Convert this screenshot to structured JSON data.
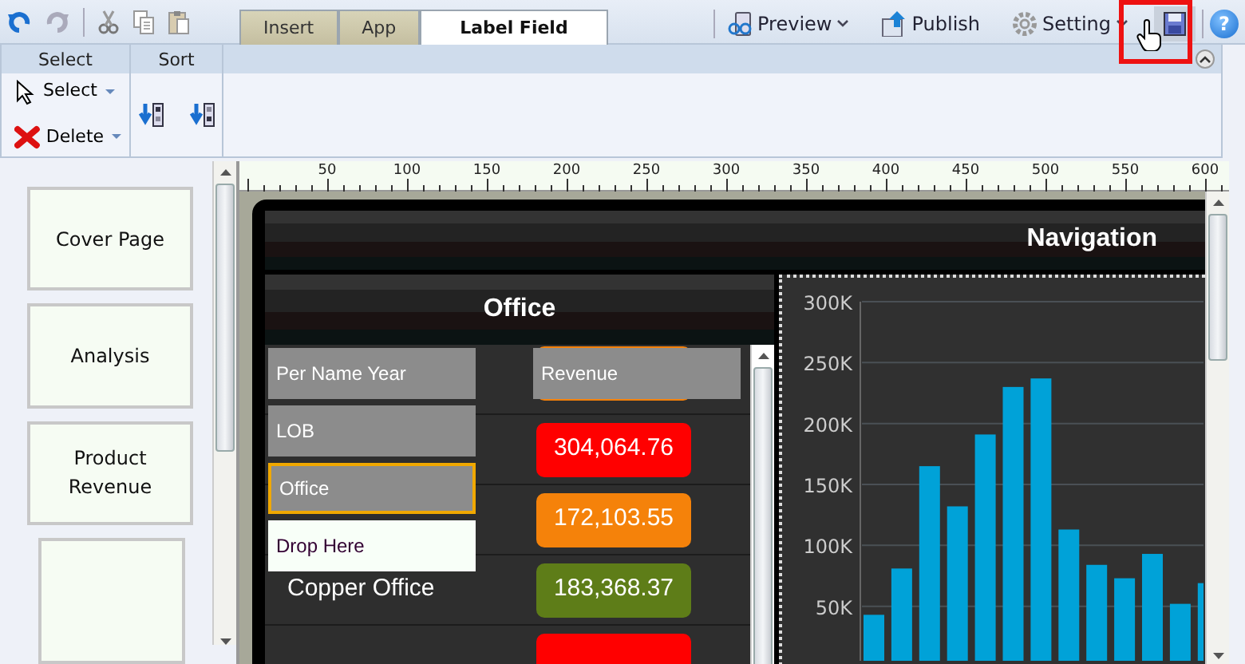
{
  "tabs": [
    {
      "label": "Insert",
      "selected": false
    },
    {
      "label": "App",
      "selected": false
    },
    {
      "label": "Label Field",
      "selected": true
    }
  ],
  "toolbar_actions": [
    {
      "label": "Preview",
      "kind": "preview"
    },
    {
      "label": "Publish",
      "kind": "publish"
    },
    {
      "label": "Setting",
      "kind": "setting"
    }
  ],
  "save": {
    "highlighted": true
  },
  "help": {
    "label": "?"
  },
  "ribbon": {
    "groups": [
      {
        "title": "Select",
        "items": [
          {
            "label": "Select",
            "kind": "pointer"
          },
          {
            "label": "Delete",
            "kind": "delete"
          }
        ]
      },
      {
        "title": "Sort",
        "items": [
          {
            "kind": "ascending"
          },
          {
            "kind": "descending"
          }
        ]
      }
    ]
  },
  "ruler": {
    "labels": [
      "50",
      "100",
      "150",
      "200",
      "250",
      "300",
      "350",
      "400",
      "450",
      "500",
      "550",
      "600"
    ]
  },
  "pages": [
    {
      "title": "Cover Page"
    },
    {
      "title": "Analysis"
    },
    {
      "title": "Product Revenue"
    }
  ],
  "more_pages_below": true,
  "dashboard": {
    "title": "Navigation",
    "office_panel": {
      "title": "Office",
      "value_field": "Revenue",
      "fields": [
        {
          "label": "Per Name Year",
          "kind": "field",
          "selected": false
        },
        {
          "label": "LOB",
          "kind": "field",
          "selected": false
        },
        {
          "label": "Office",
          "kind": "field",
          "selected": true
        },
        {
          "label": "Drop Here",
          "kind": "drop",
          "selected": false
        }
      ],
      "rows": [
        {
          "value": "304,064.76",
          "color": "#ff0000"
        },
        {
          "value": "172,103.55",
          "color": "#f5820a"
        },
        {
          "label": "Copper Office",
          "value": "183,368.37",
          "color": "#5e7d18"
        },
        {
          "color": "#ff0000"
        }
      ]
    },
    "chart_data": {
      "type": "bar",
      "ylim": [
        0,
        300000
      ],
      "grid": true,
      "yticks": [
        {
          "value": 50000,
          "label": "50K"
        },
        {
          "value": 100000,
          "label": "100K"
        },
        {
          "value": 150000,
          "label": "150K"
        },
        {
          "value": 200000,
          "label": "200K"
        },
        {
          "value": 250000,
          "label": "250K"
        },
        {
          "value": 300000,
          "label": "300K"
        }
      ],
      "series": [
        {
          "color": "#00a2d8",
          "values": [
            43000,
            81000,
            165000,
            132000,
            191000,
            230000,
            237000,
            113000,
            84000,
            73000,
            93000,
            52000,
            69000
          ]
        }
      ]
    }
  }
}
